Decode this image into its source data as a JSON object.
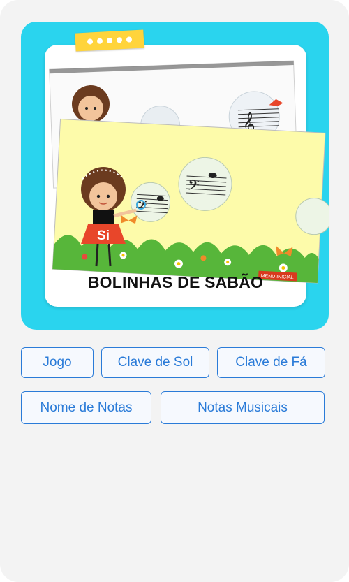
{
  "card": {
    "title": "BOLINHAS DE SABÃO",
    "menu_label": "MENU INICIAL",
    "note_label": "Si"
  },
  "buttons": [
    {
      "label": "Jogo"
    },
    {
      "label": "Clave de Sol"
    },
    {
      "label": "Clave de Fá"
    },
    {
      "label": "Nome de Notas"
    },
    {
      "label": "Notas Musicais"
    }
  ],
  "colors": {
    "frame": "#2ad4ee",
    "button_border": "#2a7bd8",
    "tape": "#ffd43b",
    "slide_bg": "#fdfbaa"
  }
}
